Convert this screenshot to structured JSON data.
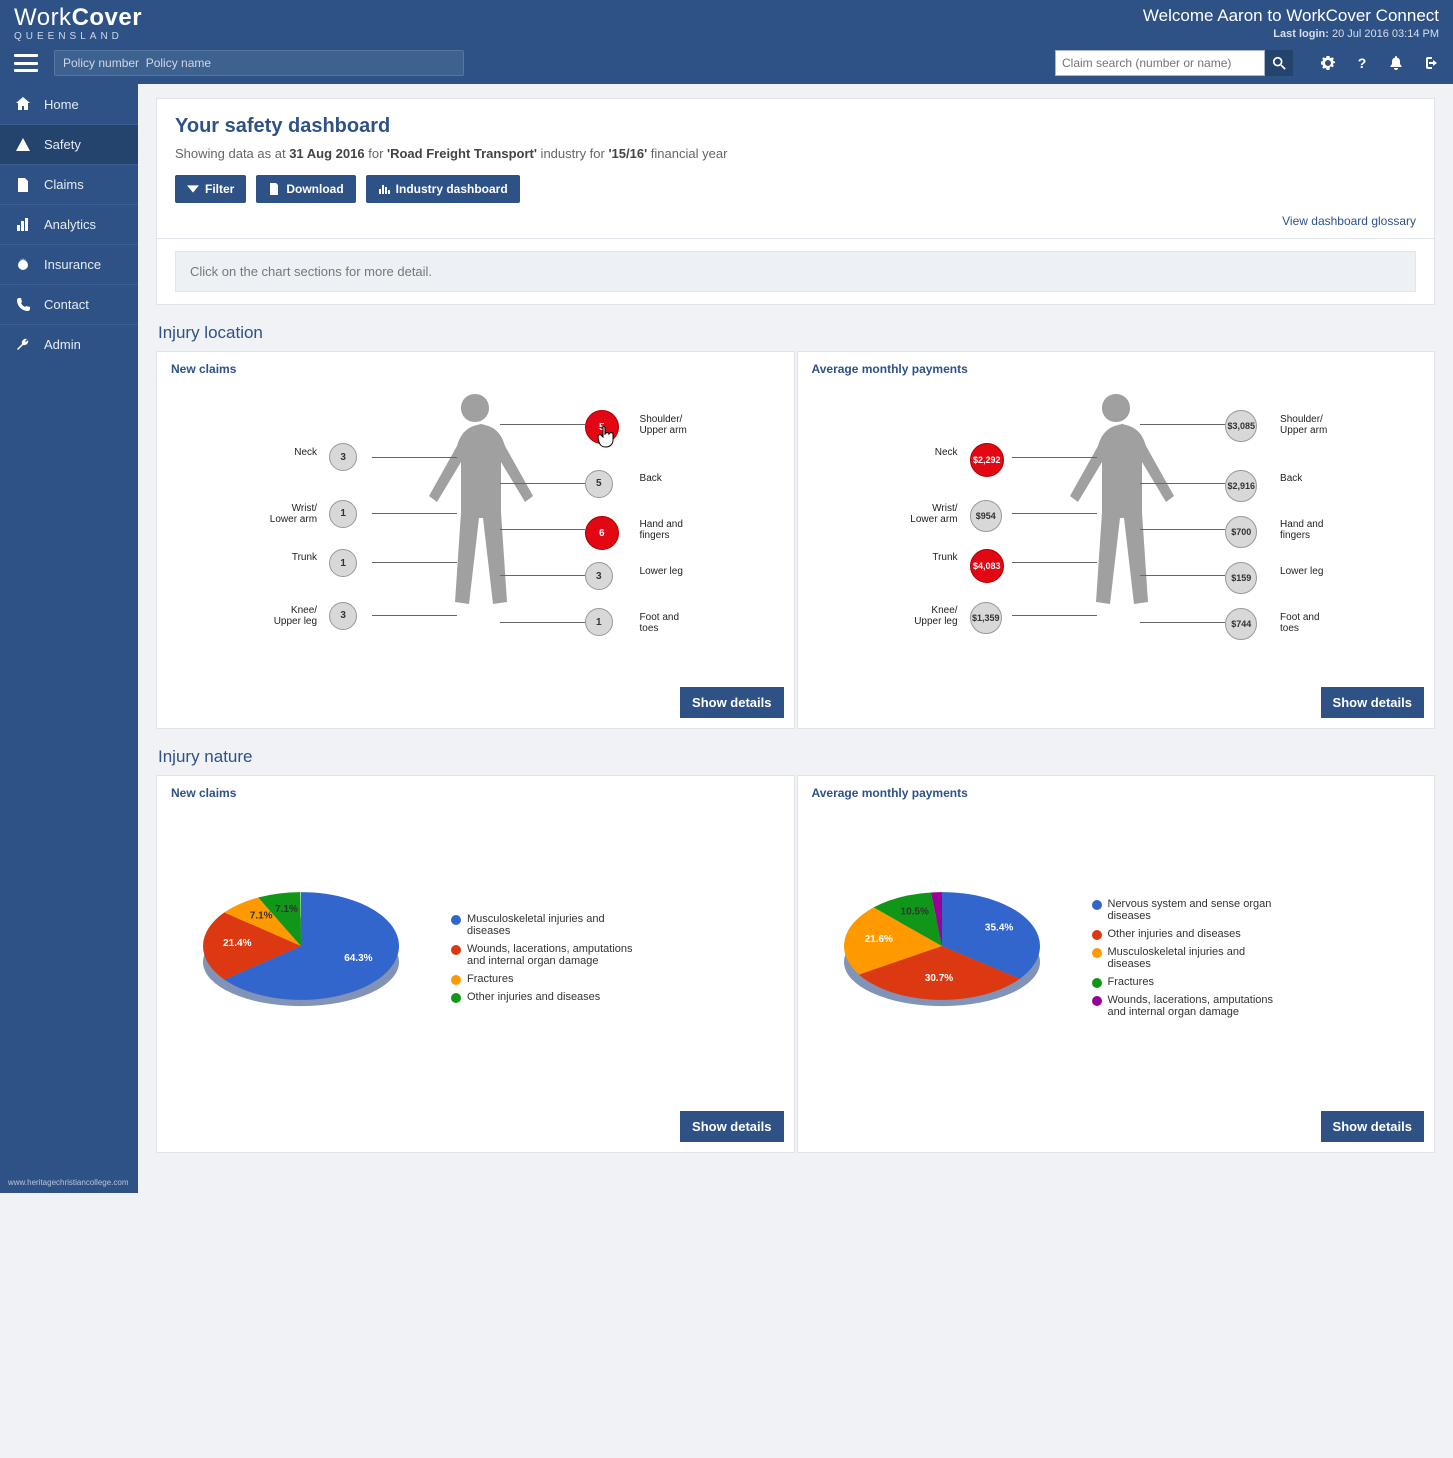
{
  "brand": {
    "line1a": "Work",
    "line1b": "Cover",
    "line2": "QUEENSLAND"
  },
  "welcome": {
    "line1_pre": "Welcome ",
    "name": "Aaron",
    "line1_post": " to WorkCover Connect",
    "lastlogin_label": "Last login:",
    "lastlogin_value": "20 Jul 2016 03:14 PM"
  },
  "policy": {
    "number": "Policy number",
    "name": "Policy name"
  },
  "search": {
    "placeholder": "Claim search (number or name)"
  },
  "sidebar": {
    "items": [
      {
        "label": "Home",
        "icon": "home-icon"
      },
      {
        "label": "Safety",
        "icon": "warning-icon"
      },
      {
        "label": "Claims",
        "icon": "document-icon"
      },
      {
        "label": "Analytics",
        "icon": "barchart-icon"
      },
      {
        "label": "Insurance",
        "icon": "badge-icon"
      },
      {
        "label": "Contact",
        "icon": "phone-icon"
      },
      {
        "label": "Admin",
        "icon": "wrench-icon"
      }
    ]
  },
  "header": {
    "title": "Your safety dashboard",
    "sub_pre": "Showing data as at ",
    "sub_date": "31 Aug 2016",
    "sub_mid1": " for ",
    "sub_industry": "'Road Freight Transport'",
    "sub_mid2": " industry for ",
    "sub_fy": "'15/16'",
    "sub_post": " financial year",
    "btn_filter": "Filter",
    "btn_download": "Download",
    "btn_industry": "Industry dashboard",
    "glossary_link": "View dashboard glossary"
  },
  "info_text": "Click on the chart sections for more detail.",
  "injury_location": {
    "title": "Injury location",
    "left": {
      "title": "New claims",
      "points": {
        "neck": {
          "label": "Neck",
          "value": "3",
          "hot": false
        },
        "wrist": {
          "label": "Wrist/\nLower arm",
          "value": "1",
          "hot": false
        },
        "trunk": {
          "label": "Trunk",
          "value": "1",
          "hot": false
        },
        "knee": {
          "label": "Knee/\nUpper leg",
          "value": "3",
          "hot": false
        },
        "shoulder": {
          "label": "Shoulder/\nUpper arm",
          "value": "5",
          "hot": true
        },
        "back": {
          "label": "Back",
          "value": "5",
          "hot": false
        },
        "hand": {
          "label": "Hand and\nfingers",
          "value": "6",
          "hot": true
        },
        "lowerleg": {
          "label": "Lower leg",
          "value": "3",
          "hot": false
        },
        "foot": {
          "label": "Foot and\ntoes",
          "value": "1",
          "hot": false
        }
      }
    },
    "right": {
      "title": "Average monthly payments",
      "points": {
        "neck": {
          "label": "Neck",
          "value": "$2,292",
          "hot": true
        },
        "wrist": {
          "label": "Wrist/\nLower arm",
          "value": "$954",
          "hot": false
        },
        "trunk": {
          "label": "Trunk",
          "value": "$4,083",
          "hot": true
        },
        "knee": {
          "label": "Knee/\nUpper leg",
          "value": "$1,359",
          "hot": false
        },
        "shoulder": {
          "label": "Shoulder/\nUpper arm",
          "value": "$3,085",
          "hot": false
        },
        "back": {
          "label": "Back",
          "value": "$2,916",
          "hot": false
        },
        "hand": {
          "label": "Hand and\nfingers",
          "value": "$700",
          "hot": false
        },
        "lowerleg": {
          "label": "Lower leg",
          "value": "$159",
          "hot": false
        },
        "foot": {
          "label": "Foot and\ntoes",
          "value": "$744",
          "hot": false
        }
      }
    },
    "show_details": "Show details"
  },
  "injury_nature": {
    "title": "Injury nature",
    "left": {
      "title": "New claims"
    },
    "right": {
      "title": "Average monthly payments"
    },
    "show_details": "Show details"
  },
  "chart_data": [
    {
      "id": "injury_nature_new_claims",
      "type": "pie",
      "title": "New claims",
      "slices": [
        {
          "name": "Musculoskeletal injuries and diseases",
          "value": 64.3,
          "label": "64.3%",
          "color": "#3366cc"
        },
        {
          "name": "Wounds, lacerations, amputations and internal organ damage",
          "value": 21.4,
          "label": "21.4%",
          "color": "#dc3912"
        },
        {
          "name": "Fractures",
          "value": 7.1,
          "label": "7.1%",
          "color": "#ff9900"
        },
        {
          "name": "Other injuries and diseases",
          "value": 7.1,
          "label": "7.1%",
          "color": "#109618"
        }
      ]
    },
    {
      "id": "injury_nature_avg_pay",
      "type": "pie",
      "title": "Average monthly payments",
      "slices": [
        {
          "name": "Nervous system and sense organ diseases",
          "value": 35.4,
          "label": "35.4%",
          "color": "#3366cc"
        },
        {
          "name": "Other injuries and diseases",
          "value": 30.7,
          "label": "30.7%",
          "color": "#dc3912"
        },
        {
          "name": "Musculoskeletal injuries and diseases",
          "value": 21.6,
          "label": "21.6%",
          "color": "#ff9900"
        },
        {
          "name": "Fractures",
          "value": 10.5,
          "label": "10.5%",
          "color": "#109618"
        },
        {
          "name": "Wounds, lacerations, amputations and internal organ damage",
          "value": 1.8,
          "label": "",
          "color": "#990099"
        }
      ]
    }
  ],
  "credit": "www.heritagechristiancollege.com"
}
